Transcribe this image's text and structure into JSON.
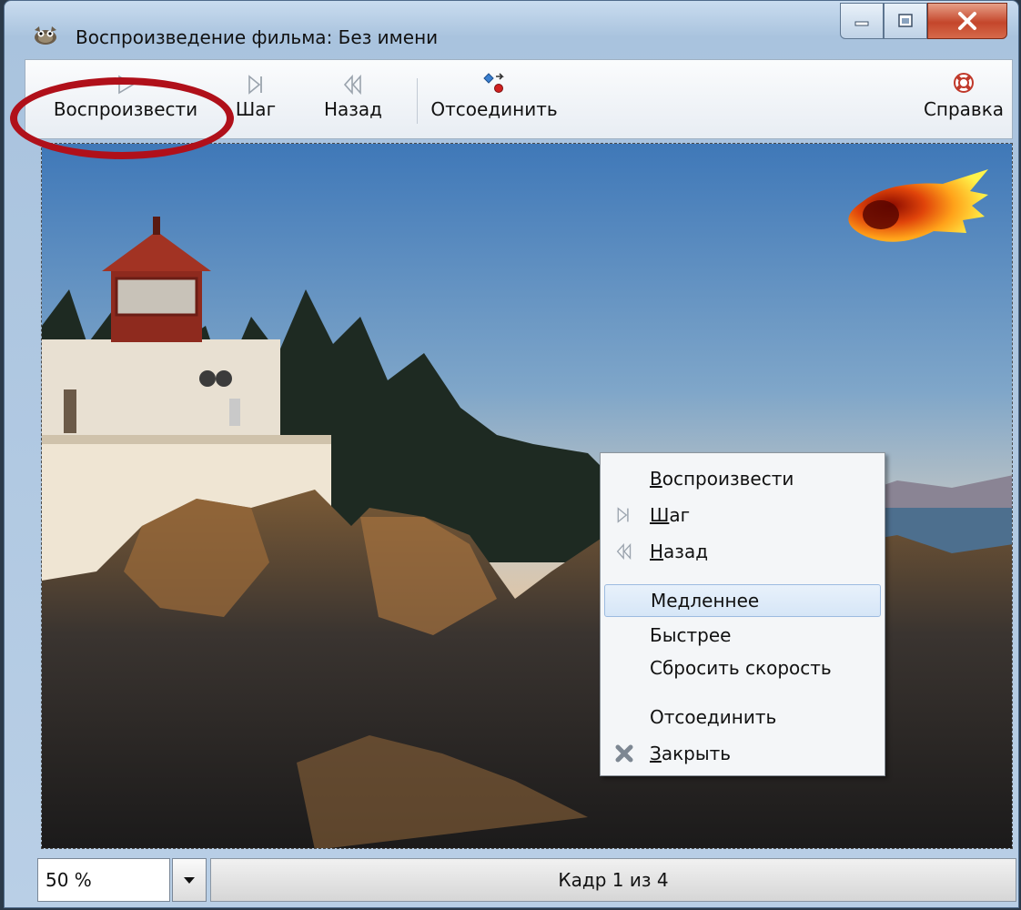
{
  "window": {
    "title": "Воспроизведение фильма: Без имени"
  },
  "toolbar": {
    "play_label": "Воспроизвести",
    "step_label": "Шаг",
    "back_label": "Назад",
    "detach_label": "Отсоединить",
    "help_label": "Справка"
  },
  "context_menu": {
    "play": {
      "first": "В",
      "rest": "оспроизвести"
    },
    "step": {
      "first": "Ш",
      "rest": "аг"
    },
    "back": {
      "first": "Н",
      "rest": "азад"
    },
    "slower": "Медленнее",
    "faster": "Быстрее",
    "reset_speed": "Сбросить скорость",
    "detach": "Отсоединить",
    "close": {
      "first": "З",
      "rest": "акрыть"
    }
  },
  "statusbar": {
    "zoom_value": "50 %",
    "frame_text": "Кадр 1 из 4"
  },
  "colors": {
    "highlight_ellipse": "#b0101a",
    "menu_hover": "#d6e6f7"
  }
}
